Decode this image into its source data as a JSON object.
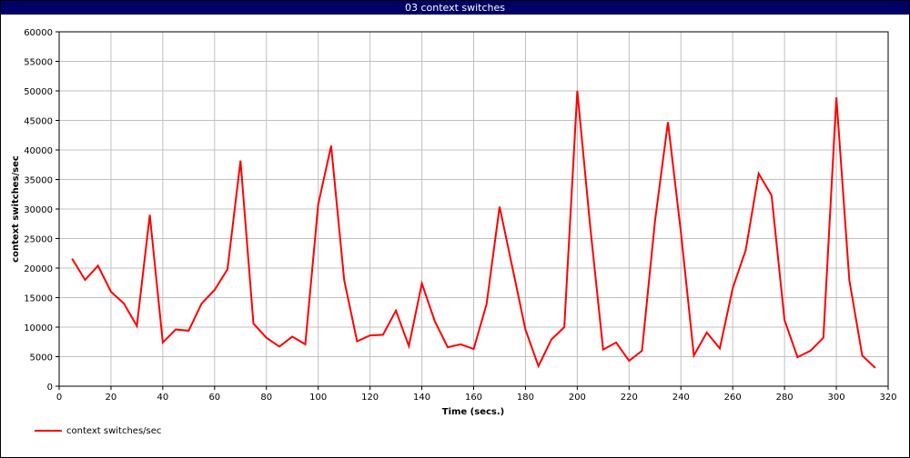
{
  "window": {
    "title": "03 context switches"
  },
  "chart_data": {
    "type": "line",
    "xlabel": "Time (secs.)",
    "ylabel": "context switches/sec",
    "xlim": [
      0,
      320
    ],
    "ylim": [
      0,
      60000
    ],
    "xticks": [
      0,
      20,
      40,
      60,
      80,
      100,
      120,
      140,
      160,
      180,
      200,
      220,
      240,
      260,
      280,
      300,
      320
    ],
    "yticks": [
      0,
      5000,
      10000,
      15000,
      20000,
      25000,
      30000,
      35000,
      40000,
      45000,
      50000,
      55000,
      60000
    ],
    "grid": true,
    "legend_position": "bottom-left",
    "series": [
      {
        "name": "context switches/sec",
        "color": "#ff0000",
        "x": [
          5,
          10,
          15,
          20,
          25,
          30,
          35,
          40,
          45,
          50,
          55,
          60,
          65,
          70,
          75,
          80,
          85,
          90,
          95,
          100,
          105,
          110,
          115,
          120,
          125,
          130,
          135,
          140,
          145,
          150,
          155,
          160,
          165,
          170,
          175,
          180,
          185,
          190,
          195,
          200,
          205,
          210,
          215,
          220,
          225,
          230,
          235,
          240,
          245,
          250,
          255,
          260,
          265,
          270,
          275,
          280,
          285,
          290,
          295,
          300,
          305,
          310,
          315
        ],
        "y": [
          21600,
          18000,
          20400,
          16000,
          14000,
          10200,
          29000,
          7400,
          9600,
          9400,
          14000,
          16300,
          19800,
          38200,
          10600,
          8200,
          6700,
          8400,
          7100,
          30800,
          40700,
          18000,
          7600,
          8600,
          8700,
          12800,
          6800,
          17400,
          11000,
          6600,
          7100,
          6300,
          13900,
          30400,
          20000,
          9600,
          3400,
          7900,
          10000,
          50000,
          27000,
          6200,
          7400,
          4300,
          6000,
          28000,
          44700,
          26000,
          5200,
          9100,
          6400,
          16600,
          23000,
          36000,
          32300,
          11200,
          4900,
          6000,
          8200,
          48900,
          18000,
          5200,
          3100
        ]
      }
    ]
  }
}
